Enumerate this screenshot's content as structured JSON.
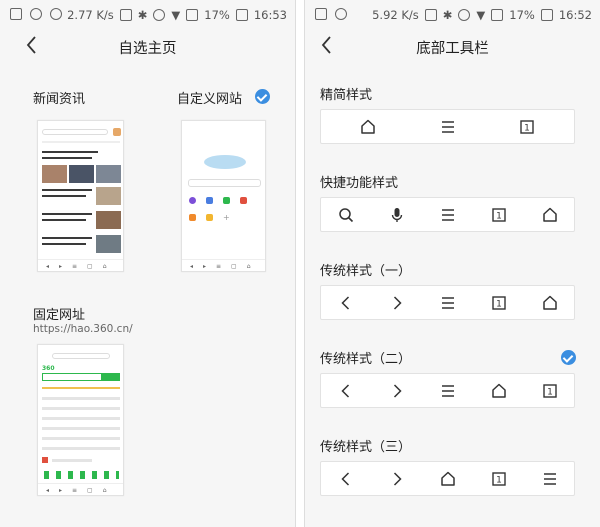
{
  "status_left": {
    "speed": "2.77 K/s",
    "battery": "17%",
    "time": "16:53"
  },
  "status_right": {
    "speed": "5.92 K/s",
    "battery": "17%",
    "time": "16:52"
  },
  "left_panel": {
    "title": "自选主页",
    "news": {
      "label": "新闻资讯"
    },
    "custom": {
      "label": "自定义网站",
      "selected": true
    },
    "fixed": {
      "label": "固定网址",
      "url": "https://hao.360.cn/"
    }
  },
  "right_panel": {
    "title": "底部工具栏",
    "styles": [
      {
        "label": "精简样式",
        "icons": [
          "home-icon",
          "menu-icon",
          "tabs-icon"
        ],
        "selected": false
      },
      {
        "label": "快捷功能样式",
        "icons": [
          "search-icon",
          "mic-icon",
          "menu-icon",
          "tabs-icon",
          "home-icon"
        ],
        "selected": false
      },
      {
        "label": "传统样式（一）",
        "icons": [
          "back-icon",
          "forward-icon",
          "menu-icon",
          "tabs-icon",
          "home-icon"
        ],
        "selected": false
      },
      {
        "label": "传统样式（二）",
        "icons": [
          "back-icon",
          "forward-icon",
          "menu-icon",
          "home-icon",
          "tabs-icon"
        ],
        "selected": true
      },
      {
        "label": "传统样式（三）",
        "icons": [
          "back-icon",
          "forward-icon",
          "home-icon",
          "tabs-icon",
          "menu-icon"
        ],
        "selected": false
      }
    ],
    "tabs_count": "1"
  },
  "colors": {
    "accent": "#3b8ee0",
    "logo_green": "#2db84d"
  }
}
